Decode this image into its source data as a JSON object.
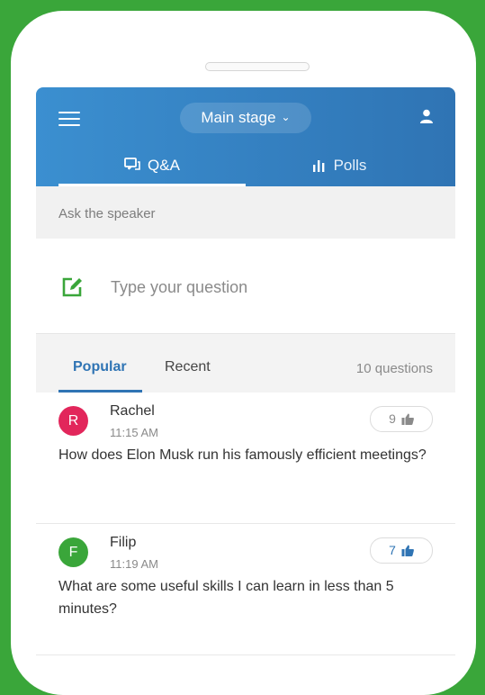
{
  "colors": {
    "background": "#3aa63a",
    "header_blue": "#2f74b4",
    "avatar_rachel": "#e2265b",
    "avatar_filip": "#3aa63a",
    "compose_icon": "#3aa63a"
  },
  "header": {
    "menu_icon": "hamburger-menu-icon",
    "stage_label": "Main stage",
    "stage_chevron": "⌄",
    "user_icon": "user-icon",
    "tabs": [
      {
        "label": "Q&A",
        "icon": "chat-bubbles-icon",
        "active": true
      },
      {
        "label": "Polls",
        "icon": "bar-chart-icon",
        "active": false
      }
    ]
  },
  "ask": {
    "label": "Ask the speaker",
    "placeholder": "Type your question",
    "icon": "edit-square-icon"
  },
  "filters": {
    "tabs": [
      {
        "label": "Popular",
        "active": true
      },
      {
        "label": "Recent",
        "active": false
      }
    ],
    "count": "10 questions"
  },
  "questions": [
    {
      "initial": "R",
      "name": "Rachel",
      "time": "11:15 AM",
      "likes": "9",
      "liked": false,
      "text": "How does Elon Musk run his famously efficient meetings?"
    },
    {
      "initial": "F",
      "name": "Filip",
      "time": "11:19 AM",
      "likes": "7",
      "liked": true,
      "text": "What are some useful skills I can learn in less than 5 minutes?"
    }
  ]
}
